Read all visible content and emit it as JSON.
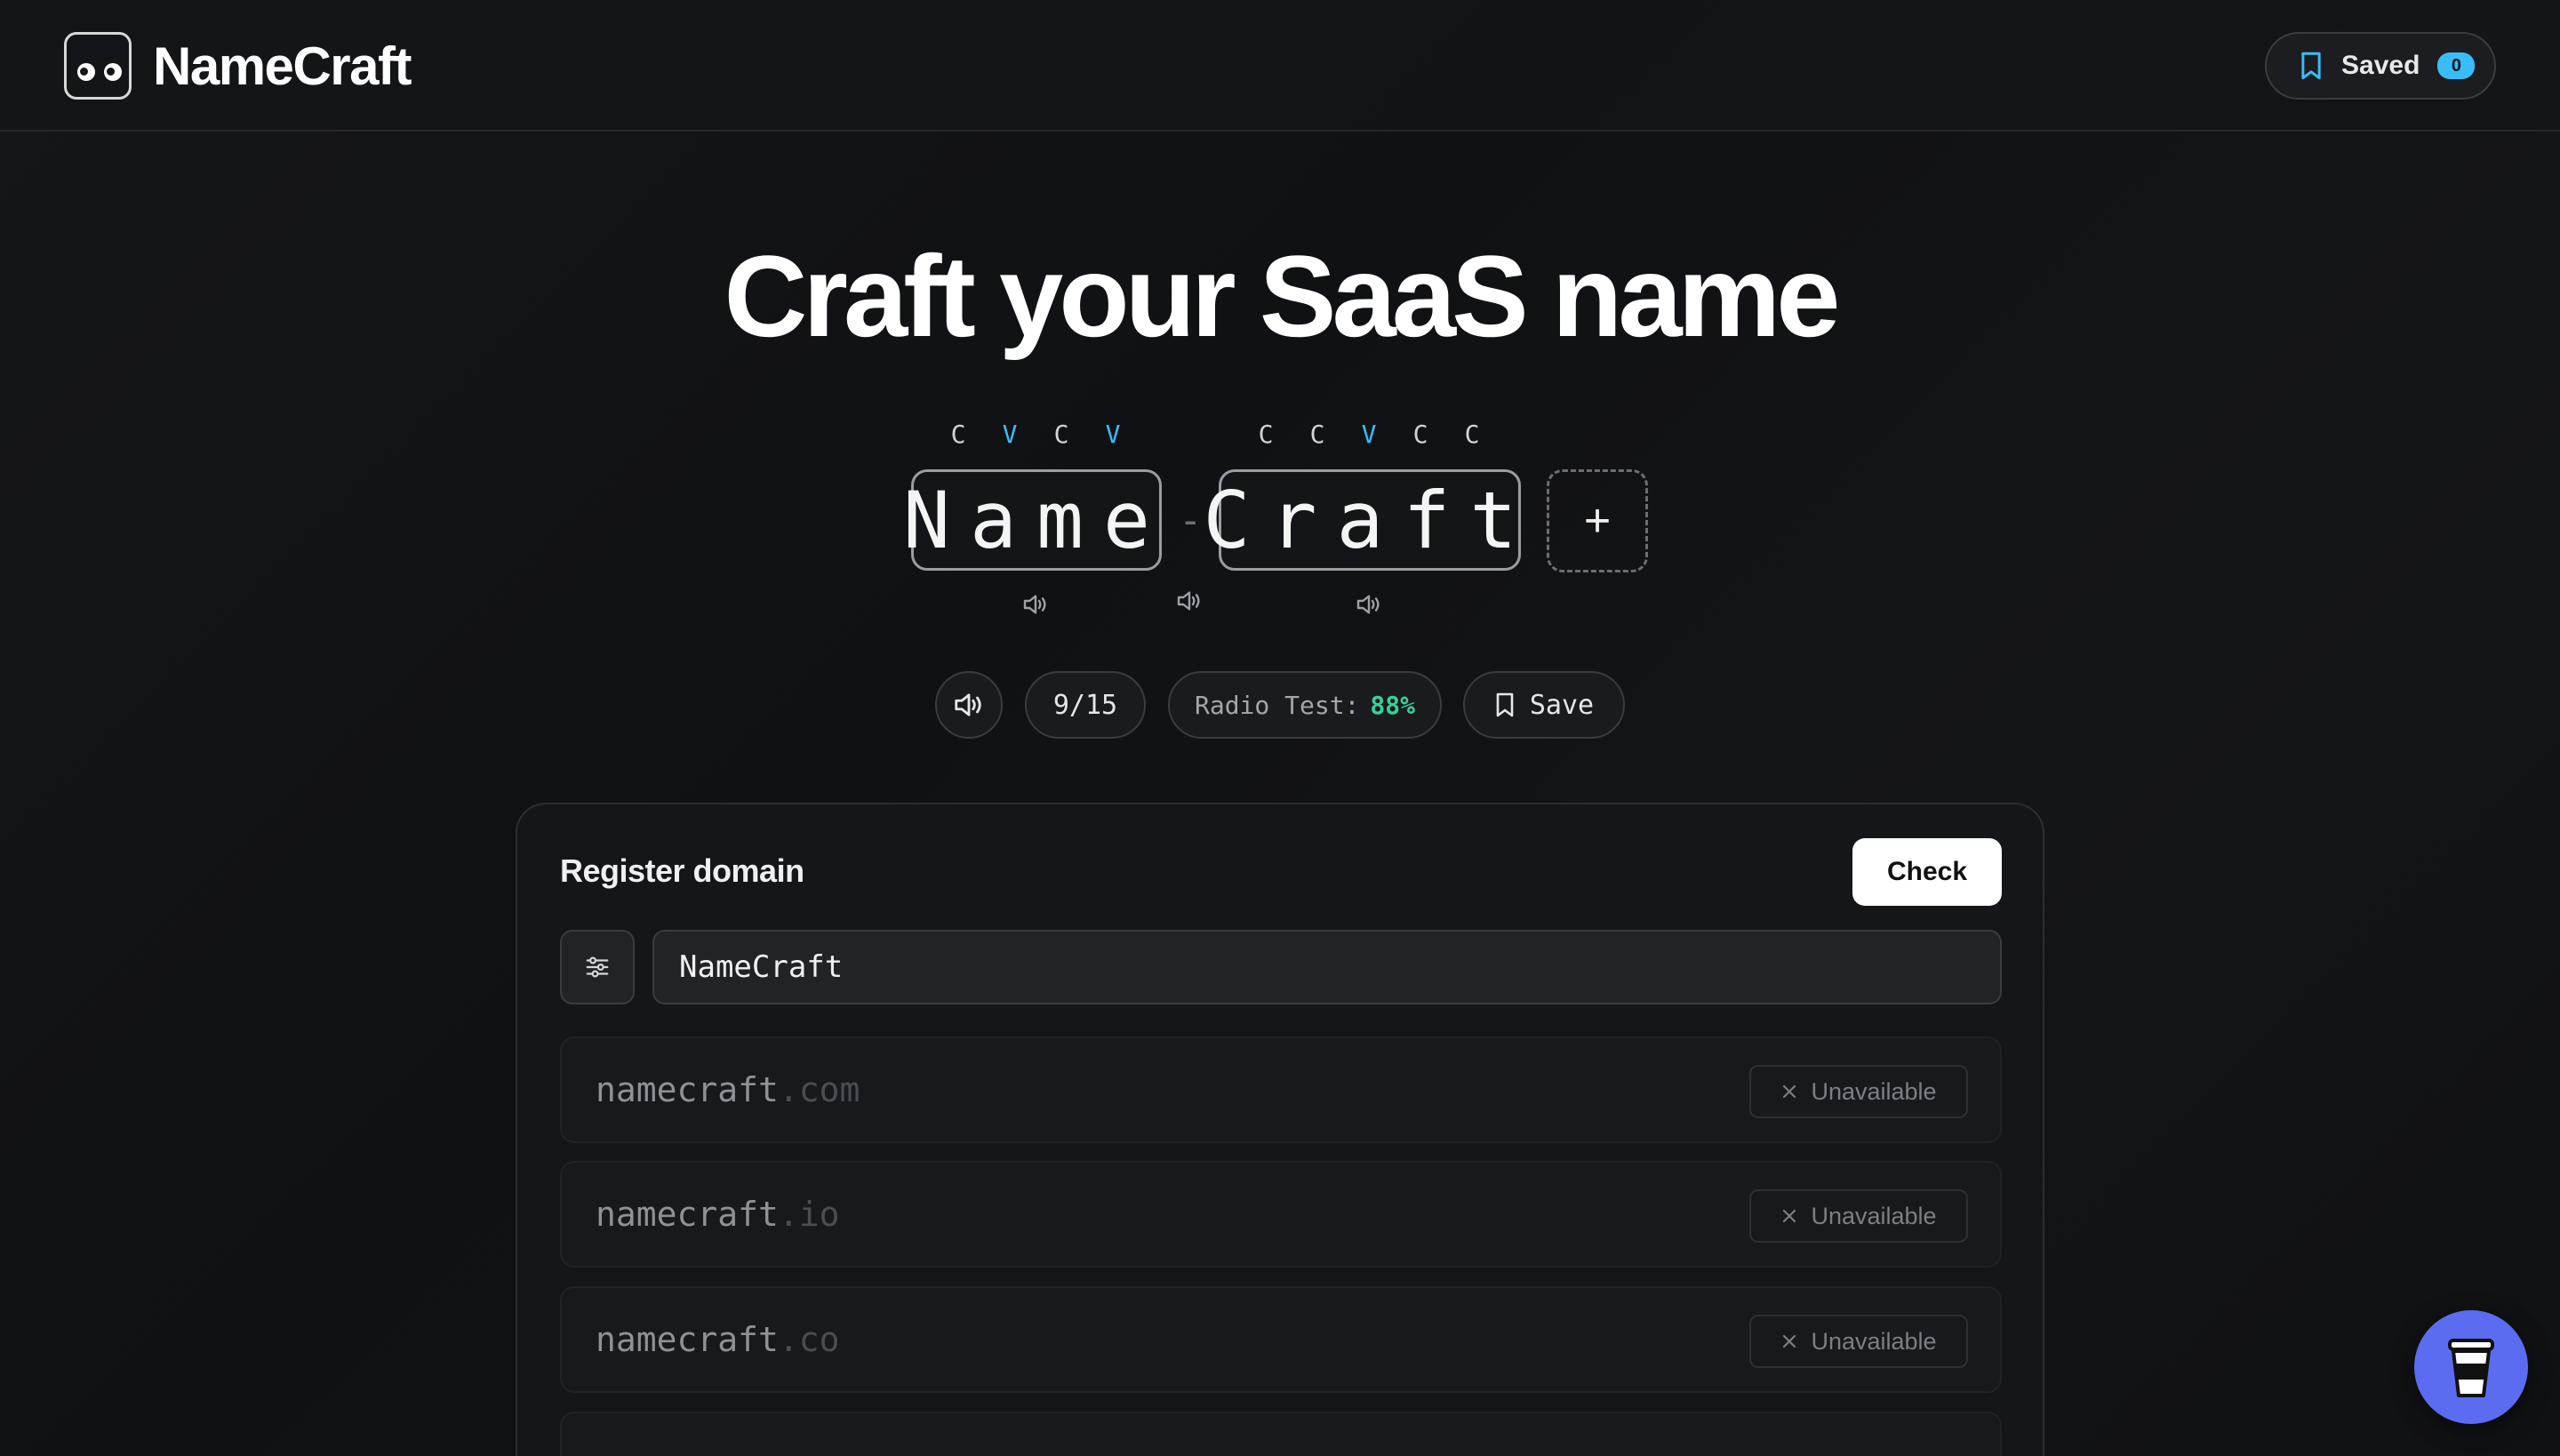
{
  "app": {
    "name": "NameCraft"
  },
  "header": {
    "saved_label": "Saved",
    "saved_count": "0"
  },
  "hero": {
    "title": "Craft your SaaS name"
  },
  "builder": {
    "segments": [
      {
        "text": "Name",
        "pattern": [
          "C",
          "V",
          "C",
          "V"
        ]
      },
      {
        "text": "Craft",
        "pattern": [
          "C",
          "C",
          "V",
          "C",
          "C"
        ]
      }
    ],
    "separator": "-",
    "add_label": "+"
  },
  "toolbar": {
    "length": "9/15",
    "radio_label": "Radio Test:",
    "radio_value": "88%",
    "save_label": "Save"
  },
  "domain": {
    "title": "Register domain",
    "check_label": "Check",
    "input_value": "NameCraft",
    "results": [
      {
        "name": "namecraft",
        "tld": ".com",
        "status": "Unavailable"
      },
      {
        "name": "namecraft",
        "tld": ".io",
        "status": "Unavailable"
      },
      {
        "name": "namecraft",
        "tld": ".co",
        "status": "Unavailable"
      }
    ]
  },
  "colors": {
    "accent": "#38bdf8",
    "success": "#34d399",
    "coffee": "#5b6cf0"
  }
}
